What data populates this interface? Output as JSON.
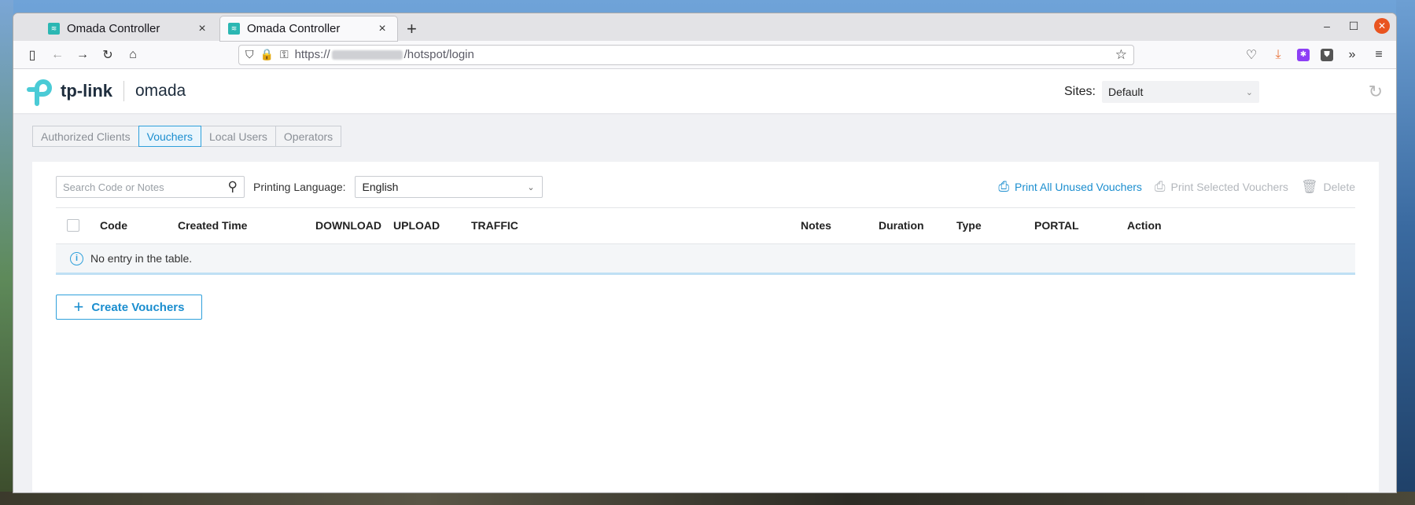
{
  "browser": {
    "tabs": [
      {
        "title": "Omada Controller",
        "close": "×"
      },
      {
        "title": "Omada Controller",
        "close": "×"
      }
    ],
    "new_tab": "+",
    "url_prefix": "https://",
    "url_suffix": "/hotspot/login",
    "icons": [
      "sidebar-icon",
      "back-icon",
      "forward-icon",
      "reload-icon",
      "home-icon",
      "shield-icon",
      "lock-icon",
      "permissions-icon",
      "star-icon",
      "pocket-icon",
      "download-icon",
      "extension-icon",
      "bitwarden-icon",
      "overflow-icon",
      "menu-icon"
    ]
  },
  "header": {
    "brand": "tp-link",
    "product": "omada",
    "sites_label": "Sites:",
    "sites_value": "Default"
  },
  "subtabs": [
    {
      "label": "Authorized Clients",
      "active": false
    },
    {
      "label": "Vouchers",
      "active": true
    },
    {
      "label": "Local Users",
      "active": false
    },
    {
      "label": "Operators",
      "active": false
    }
  ],
  "toolbar": {
    "search_placeholder": "Search Code or Notes",
    "printing_language_label": "Printing Language:",
    "printing_language_value": "English",
    "print_all": "Print All Unused Vouchers",
    "print_selected": "Print Selected Vouchers",
    "delete": "Delete"
  },
  "table": {
    "columns": [
      "Code",
      "Created Time",
      "DOWNLOAD",
      "UPLOAD",
      "TRAFFIC",
      "Notes",
      "Duration",
      "Type",
      "PORTAL",
      "Action"
    ],
    "empty_message": "No entry in the table."
  },
  "create_button": "Create Vouchers",
  "colors": {
    "accent": "#1b8ecf",
    "close_button": "#e95420"
  }
}
